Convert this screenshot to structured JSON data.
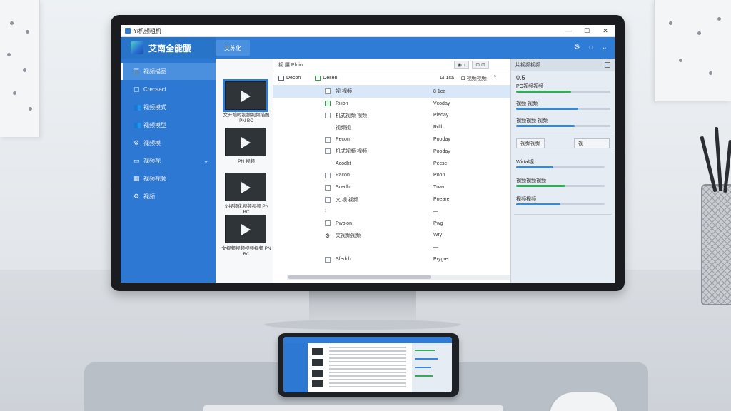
{
  "window": {
    "title": "Yi机频粗机"
  },
  "header": {
    "brand_name": "艾南全能腰",
    "tab_label": "艾苏化",
    "icons": [
      "gear-icon",
      "help-icon",
      "chevron-down-icon"
    ]
  },
  "window_controls": {
    "minimize": "—",
    "maximize": "☐",
    "close": "✕"
  },
  "sidebar": {
    "items": [
      {
        "label": "视频描图",
        "icon": "list-icon",
        "active": true
      },
      {
        "label": "Crecaaci",
        "icon": "video-icon",
        "active": false
      },
      {
        "label": "视频模式",
        "icon": "users-icon",
        "active": false
      },
      {
        "label": "视频模型",
        "icon": "users-icon",
        "active": false
      },
      {
        "label": "视频模",
        "icon": "gear-icon",
        "active": false
      },
      {
        "label": "视频视",
        "icon": "folder-icon",
        "active": false,
        "has_chevron": true
      },
      {
        "label": "视频视频",
        "icon": "grid-icon",
        "active": false
      },
      {
        "label": "视频",
        "icon": "gear-icon",
        "active": false
      }
    ]
  },
  "thumbnails": [
    {
      "caption": "文开始时视频视频描图 PN BC",
      "selected": true
    },
    {
      "caption": "PN 视频",
      "selected": false
    },
    {
      "caption": "文视频化视频视频 PN BC",
      "selected": false
    },
    {
      "caption": "文视频视频视频视频 PN BC",
      "selected": false
    }
  ],
  "path_bar": {
    "path": "视 腰 Pfoio",
    "sort_label": "◉ ↓",
    "split_label": "⊡ ⊡"
  },
  "toolbar": {
    "items": [
      "Decon",
      "Desen"
    ],
    "right_items": [
      "⊡ 1ca",
      "⊡ 视频视频",
      "^"
    ]
  },
  "file_rows": [
    {
      "name": "视 视频",
      "status": "8 1ca",
      "selected": true,
      "checkbox": "plain",
      "control": "selbox"
    },
    {
      "name": "Rilion",
      "status": "Vcoday",
      "checkbox": "green",
      "control": "toggle-on",
      "chevron": "+"
    },
    {
      "name": "机式视频 视频",
      "status": "Pleday",
      "checkbox": "plain",
      "control": "toggle"
    },
    {
      "name": "视频视",
      "status": "Rdlb",
      "checkbox": "none",
      "control": "toggle"
    },
    {
      "name": "Pecon",
      "status": "Pooday",
      "checkbox": "plain",
      "control": "toggle"
    },
    {
      "name": "机式视频 视频",
      "status": "Pooday",
      "checkbox": "plain",
      "control": "toggle",
      "chevron": "⌄"
    },
    {
      "name": "Acodkt",
      "status": "Pecsc",
      "checkbox": "none",
      "control": "toggle"
    },
    {
      "name": "Pacon",
      "status": "Poon",
      "checkbox": "plain",
      "control": "toggle"
    },
    {
      "name": "Scedh",
      "status": "Tnav",
      "checkbox": "plain",
      "control": "toggle"
    },
    {
      "name": "文 视 视频",
      "status": "Poeare",
      "checkbox": "plain",
      "control": "toggle",
      "chevron": "⌄"
    },
    {
      "name": "",
      "status": "—",
      "checkbox": "chev",
      "control": "toggle"
    },
    {
      "name": "Pwolon",
      "status": "Pwg",
      "checkbox": "plain",
      "control": "toggle"
    },
    {
      "name": "文视频视频",
      "status": "Wry",
      "checkbox": "gear",
      "control": "toggle",
      "chevron": "⌄"
    },
    {
      "name": "",
      "status": "—",
      "checkbox": "none",
      "control": "toggle"
    },
    {
      "name": "Sfedch",
      "status": "Prygre",
      "checkbox": "plain",
      "control": "toggle"
    }
  ],
  "right_panel": {
    "header": "片视频视频",
    "value": "0.5",
    "tasks": [
      {
        "label": "PO视频视频",
        "progress": 0.58,
        "color": "#2fae57"
      },
      {
        "label": "视频 视频",
        "progress": 0.66,
        "color": "#3a86d9"
      },
      {
        "label": "视频视频 视频",
        "progress": 0.62,
        "color": "#3a86d9"
      }
    ],
    "button_left": "视频视频",
    "button_right": "视",
    "section2": [
      {
        "label": "Wirtal视",
        "progress": 0.42,
        "color": "#3a86d9"
      },
      {
        "label": "视频视频视频",
        "progress": 0.56,
        "color": "#2fae57"
      },
      {
        "label": "视频视频",
        "progress": 0.5,
        "color": "#3a86d9"
      }
    ]
  }
}
